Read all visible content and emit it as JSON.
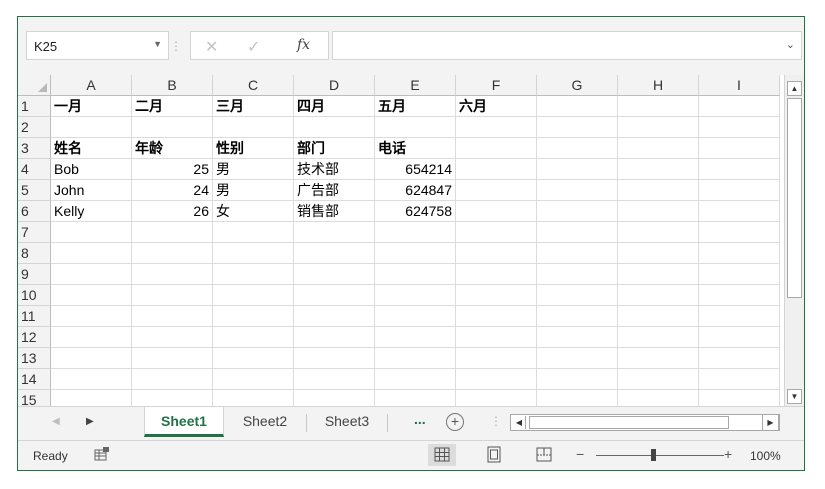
{
  "name_box": {
    "value": "K25"
  },
  "formula_bar": {
    "value": ""
  },
  "columns": [
    "A",
    "B",
    "C",
    "D",
    "E",
    "F",
    "G",
    "H",
    "I"
  ],
  "rows": [
    "1",
    "2",
    "3",
    "4",
    "5",
    "6",
    "7",
    "8",
    "9",
    "10",
    "11",
    "12",
    "13",
    "14",
    "15"
  ],
  "cells": {
    "A1": "一月",
    "B1": "二月",
    "C1": "三月",
    "D1": "四月",
    "E1": "五月",
    "F1": "六月",
    "A3": "姓名",
    "B3": "年龄",
    "C3": "性别",
    "D3": "部门",
    "E3": "电话",
    "A4": "Bob",
    "B4": "25",
    "C4": "男",
    "D4": "技术部",
    "E4": "654214",
    "A5": "John",
    "B5": "24",
    "C5": "男",
    "D5": "广告部",
    "E5": "624847",
    "A6": "Kelly",
    "B6": "26",
    "C6": "女",
    "D6": "销售部",
    "E6": "624758"
  },
  "sheets": {
    "tabs": [
      {
        "label": "Sheet1",
        "active": true
      },
      {
        "label": "Sheet2",
        "active": false
      },
      {
        "label": "Sheet3",
        "active": false
      }
    ],
    "more_label": "..."
  },
  "status": {
    "ready": "Ready",
    "zoom": "100%"
  },
  "colors": {
    "accent": "#217346",
    "gridline": "#dadcdd",
    "header_bg": "#f3f3f3"
  },
  "icons": [
    "dropdown-icon",
    "cancel-icon",
    "enter-icon",
    "function-icon",
    "add-sheet-icon",
    "macro-record-icon",
    "normal-view-icon",
    "page-layout-icon",
    "page-break-icon"
  ]
}
